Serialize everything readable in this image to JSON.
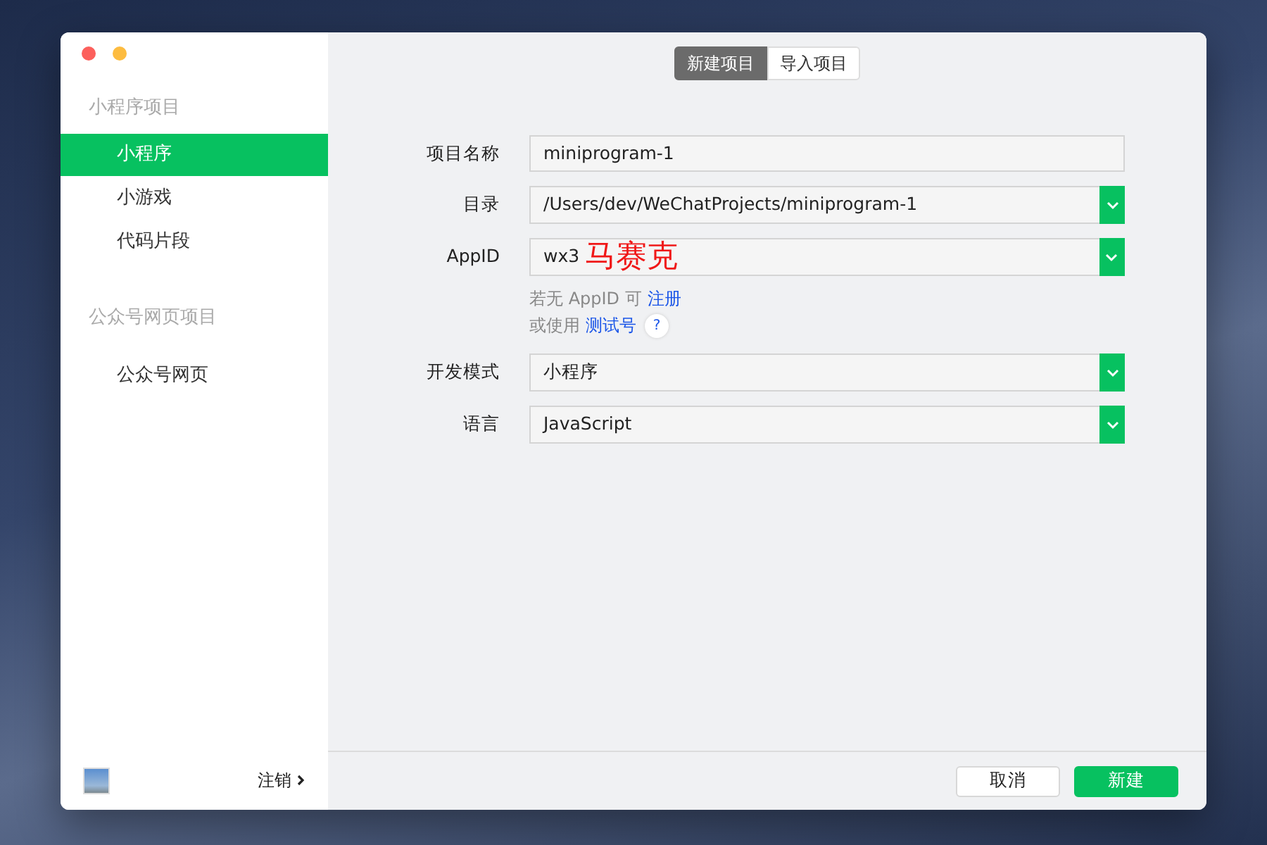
{
  "sidebar": {
    "sections": [
      {
        "title": "小程序项目",
        "items": [
          {
            "label": "小程序",
            "selected": true
          },
          {
            "label": "小游戏",
            "selected": false
          },
          {
            "label": "代码片段",
            "selected": false
          }
        ]
      },
      {
        "title": "公众号网页项目",
        "items": [
          {
            "label": "公众号网页",
            "selected": false
          }
        ]
      }
    ],
    "logout": "注销"
  },
  "tabs": [
    {
      "label": "新建项目",
      "selected": true
    },
    {
      "label": "导入项目",
      "selected": false
    }
  ],
  "form": {
    "fields": [
      {
        "label": "项目名称",
        "kind": "text",
        "value": "miniprogram-1"
      },
      {
        "label": "目录",
        "kind": "select",
        "value": "/Users/dev/WeChatProjects/miniprogram-1"
      },
      {
        "label": "AppID",
        "kind": "select",
        "value": "wx3",
        "annotation": "马赛克",
        "hints": [
          {
            "text": "若无 AppID 可",
            "link": "注册"
          },
          {
            "text": "或使用",
            "link": "测试号",
            "help": "?"
          }
        ]
      },
      {
        "label": "开发模式",
        "kind": "select",
        "value": "小程序"
      },
      {
        "label": "语言",
        "kind": "select",
        "value": "JavaScript"
      }
    ]
  },
  "buttons": [
    {
      "label": "取消",
      "kind": "secondary"
    },
    {
      "label": "新建",
      "kind": "primary"
    }
  ]
}
